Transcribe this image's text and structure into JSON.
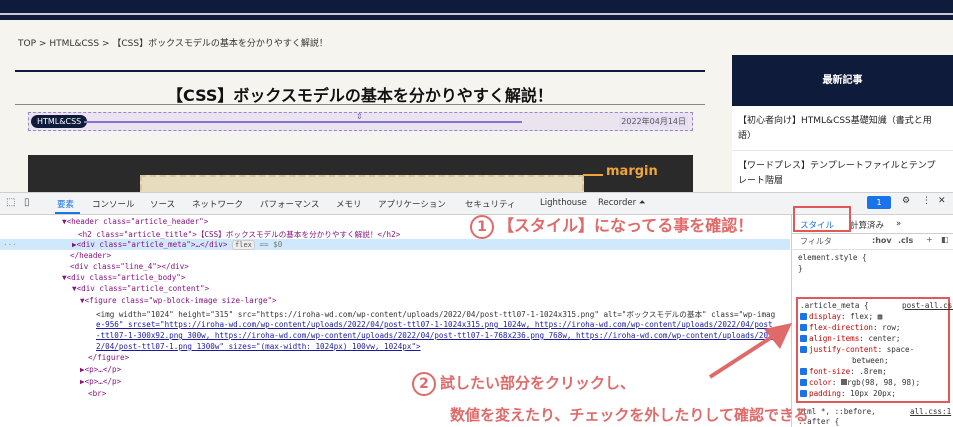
{
  "breadcrumb": {
    "top": "TOP",
    "sep1": ">",
    "cat": "HTML&CSS",
    "sep2": ">",
    "current": "【CSS】ボックスモデルの基本を分かりやすく解説！"
  },
  "article": {
    "title": "【CSS】ボックスモデルの基本を分かりやすく解説！",
    "category": "HTML&CSS",
    "date": "2022年04月14日",
    "margin_label": "margin"
  },
  "sidebar": {
    "heading": "最新記事",
    "items": [
      "【初心者向け】HTML&CSS基礎知識（書式と用語）",
      "【ワードプレス】テンプレートファイルとテンプレート階層"
    ]
  },
  "devtools": {
    "tabs": [
      "要素",
      "コンソール",
      "ソース",
      "ネットワーク",
      "パフォーマンス",
      "メモリ",
      "アプリケーション",
      "セキュリティ",
      "Lighthouse",
      "Recorder ⏶"
    ],
    "issues_count": "1",
    "dom_lines": [
      "▼<header class=\"article_header\">",
      "<h2 class=\"article_title\">【CSS】ボックスモデルの基本を分かりやすく解説！</h2>",
      "▶<div class=\"article_meta\">…</div>",
      "</header>",
      "<div class=\"line_4\"></div>",
      "▼<div class=\"article_body\">",
      "▼<div class=\"article_content\">",
      "▼<figure class=\"wp-block-image size-large\">",
      "<img width=\"1024\" height=\"315\" src=\"https://iroha-wd.com/wp-content/uploads/2022/04/post-ttl07-1-1024x315.png\" alt=\"ボックスモデルの基本\" class=\"wp-imag",
      "e-956\" srcset=\"https://iroha-wd.com/wp-content/uploads/2022/04/post-ttl07-1-1024x315.png 1024w, https://iroha-wd.com/wp-content/uploads/2022/04/post",
      "-ttl07-1-300x92.png 300w, https://iroha-wd.com/wp-content/uploads/2022/04/post-ttl07-1-768x236.png 768w, https://iroha-wd.com/wp-content/uploads/202",
      "2/04/post-ttl07-1.png 1300w\" sizes=\"(max-width: 1024px) 100vw, 1024px\">",
      "</figure>",
      "▶<p>…</p>",
      "▶<p>…</p>",
      "<br>"
    ],
    "flex_pill": "flex",
    "dollar": "== $0",
    "styles": {
      "tab_styles": "スタイル",
      "tab_computed": "計算済み",
      "tab_more": "»",
      "filter_placeholder": "フィルタ",
      "hov": ":hov",
      "cls": ".cls",
      "plus": "+",
      "element_style": "element.style {",
      "close": "}",
      "selector": ".article_meta {",
      "source": "post-all.css:",
      "props": [
        {
          "name": "display",
          "value": "flex;"
        },
        {
          "name": "flex-direction",
          "value": "row;"
        },
        {
          "name": "align-items",
          "value": "center;"
        },
        {
          "name": "justify-content",
          "value": "space-"
        },
        {
          "name": "",
          "value": "between;"
        },
        {
          "name": "font-size",
          "value": ".8rem;"
        },
        {
          "name": "color",
          "value": "rgb(98, 98, 98);"
        },
        {
          "name": "padding",
          "value": "10px 20px;"
        }
      ],
      "next_selector": "html *, ::before,",
      "next_source": "all.css:1",
      "next_selector2": "::after {"
    }
  },
  "annotations": {
    "one_num": "1",
    "one": "【スタイル】になってる事を確認！",
    "two_num": "2",
    "two": "試したい部分をクリックし、",
    "three": "数値を変えたり、チェックを外したりして確認できる"
  },
  "colors": {
    "navy": "#0e1b3a",
    "annotation": "#e06a6a",
    "devtools_blue": "#1a73e8"
  }
}
